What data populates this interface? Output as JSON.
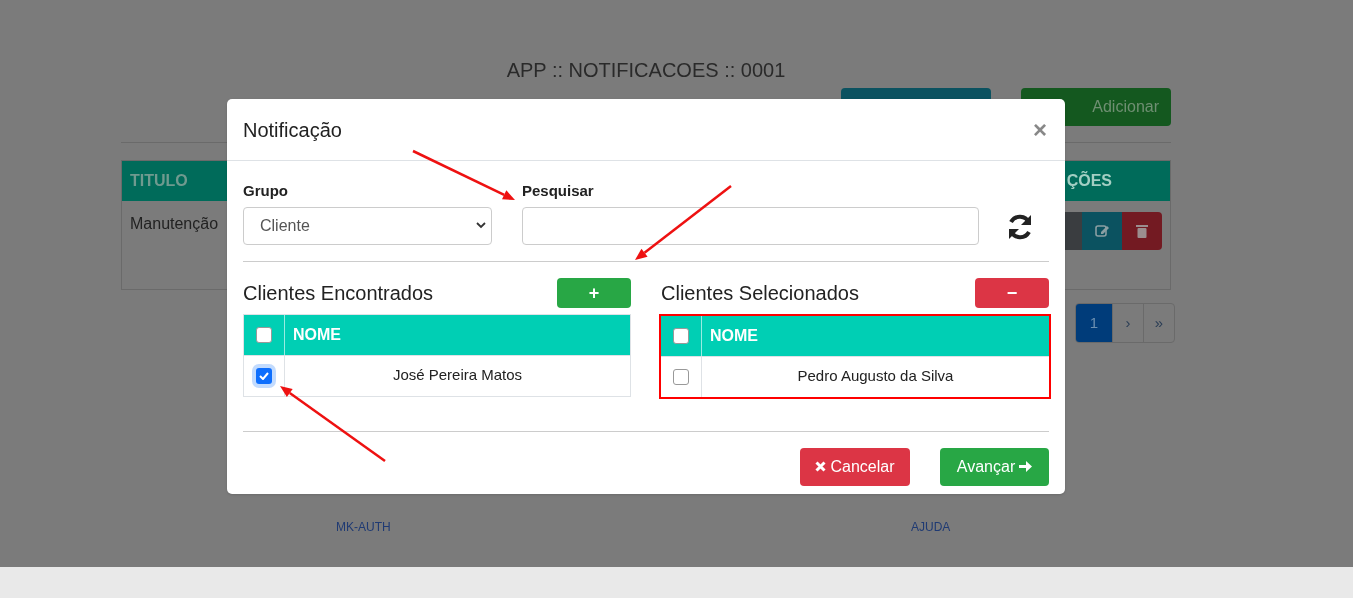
{
  "page": {
    "title": "APP :: NOTIFICACOES :: 0001",
    "add_button": "Adicionar",
    "table": {
      "columns": [
        "TITULO",
        "ÇÕES"
      ],
      "rows": [
        {
          "title": "Manutenção"
        }
      ]
    },
    "pagination": [
      {
        "label": "1",
        "selected": true
      },
      {
        "label": "›",
        "selected": false
      },
      {
        "label": "»",
        "selected": false
      }
    ],
    "footer_links": [
      "MK-AUTH",
      "AJUDA"
    ]
  },
  "modal": {
    "title": "Notificação",
    "close": "×",
    "group": {
      "label": "Grupo",
      "value": "Cliente"
    },
    "search": {
      "label": "Pesquisar"
    },
    "found": {
      "title": "Clientes Encontrados",
      "button": "+",
      "header_checked": false,
      "column": "NOME",
      "rows": [
        {
          "name": "José Pereira Matos",
          "checked": true
        }
      ]
    },
    "selected": {
      "title": "Clientes Selecionados",
      "button": "−",
      "header_checked": false,
      "column": "NOME",
      "rows": [
        {
          "name": "Pedro Augusto da Silva",
          "checked": false
        }
      ]
    },
    "buttons": [
      {
        "kind": "cancel",
        "label": "Cancelar"
      },
      {
        "kind": "next",
        "label": "Avançar"
      }
    ]
  }
}
